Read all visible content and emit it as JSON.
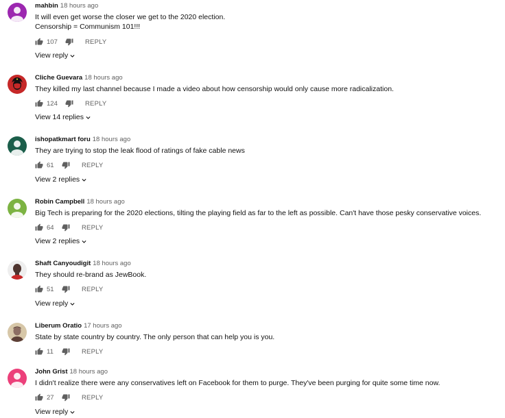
{
  "comments": [
    {
      "author": "mahbin",
      "time": "18 hours ago",
      "lines": [
        "It will even get worse the closer we get to the 2020 election.",
        "Censorship = Communism 101!!!"
      ],
      "likes": "107",
      "reply_label": "REPLY",
      "view_replies": "View reply",
      "avatar_color": "#9c27b0",
      "avatar_icon": "person-icon"
    },
    {
      "author": "Cliche Guevara",
      "time": "18 hours ago",
      "lines": [
        "They killed my last channel because I made a video about how censorship would only cause more radicalization."
      ],
      "likes": "124",
      "reply_label": "REPLY",
      "view_replies": "View 14 replies",
      "avatar_color": "#c62828",
      "avatar_icon": "che-portrait-icon"
    },
    {
      "author": "ishopatkmart foru",
      "time": "18 hours ago",
      "lines": [
        "They are trying to stop the leak flood of ratings of fake cable news"
      ],
      "likes": "61",
      "reply_label": "REPLY",
      "view_replies": "View 2 replies",
      "avatar_color": "#1b5e4a",
      "avatar_icon": "person-icon"
    },
    {
      "author": "Robin Campbell",
      "time": "18 hours ago",
      "lines": [
        "Big Tech is preparing for the 2020 elections, tilting the playing field as far to the left as possible. Can't have those pesky conservative voices."
      ],
      "likes": "64",
      "reply_label": "REPLY",
      "view_replies": "View 2 replies",
      "avatar_color": "#7cb342",
      "avatar_icon": "person-icon"
    },
    {
      "author": "Shaft Canyoudigit",
      "time": "18 hours ago",
      "lines": [
        "They should re-brand as JewBook."
      ],
      "likes": "51",
      "reply_label": "REPLY",
      "view_replies": "View reply",
      "avatar_color": "#e0e0e0",
      "avatar_icon": "portrait-photo-icon"
    },
    {
      "author": "Liberum Oratio",
      "time": "17 hours ago",
      "lines": [
        "State by state country by country.  The only person that can help you is you."
      ],
      "likes": "11",
      "reply_label": "REPLY",
      "view_replies": "",
      "avatar_color": "#d7c7a8",
      "avatar_icon": "portrait-photo-icon"
    },
    {
      "author": "John Grist",
      "time": "18 hours ago",
      "lines": [
        "I didn't realize there were any conservatives left on Facebook for them to purge. They've been purging for quite some time now."
      ],
      "likes": "27",
      "reply_label": "REPLY",
      "view_replies": "View reply",
      "avatar_color": "#ec407a",
      "avatar_icon": "person-icon"
    }
  ]
}
